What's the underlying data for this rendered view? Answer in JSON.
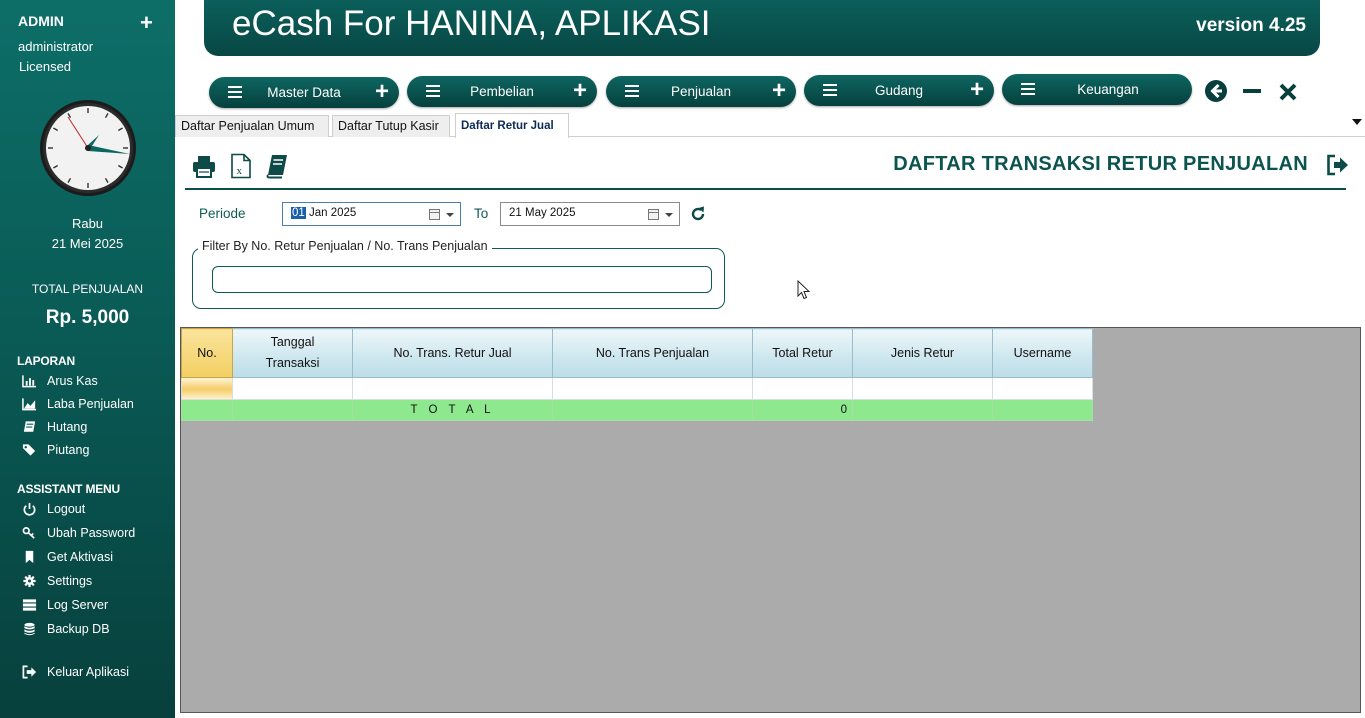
{
  "sidebar": {
    "role": "ADMIN",
    "user": "administrator",
    "license": "Licensed",
    "day": "Rabu",
    "date": "21 Mei 2025",
    "total_penjualan_label": "TOTAL PENJUALAN",
    "total_penjualan_value": "Rp. 5,000",
    "laporan_title": "LAPORAN",
    "laporan": [
      {
        "label": "Arus Kas",
        "icon": "bar-chart-icon"
      },
      {
        "label": "Laba Penjualan",
        "icon": "area-chart-icon"
      },
      {
        "label": "Hutang",
        "icon": "book-icon"
      },
      {
        "label": "Piutang",
        "icon": "tags-icon"
      }
    ],
    "assistant_title": "ASSISTANT MENU",
    "assistant": [
      {
        "label": "Logout",
        "icon": "power-icon"
      },
      {
        "label": "Ubah Password",
        "icon": "key-icon"
      },
      {
        "label": "Get Aktivasi",
        "icon": "bookmark-icon"
      },
      {
        "label": "Settings",
        "icon": "gear-icon"
      },
      {
        "label": "Log Server",
        "icon": "server-icon"
      },
      {
        "label": "Backup DB",
        "icon": "database-icon"
      }
    ],
    "exit_label": "Keluar Aplikasi"
  },
  "header": {
    "title": "eCash For HANINA, APLIKASI",
    "version": "version 4.25"
  },
  "menu": [
    "Master Data",
    "Pembelian",
    "Penjualan",
    "Gudang",
    "Keuangan"
  ],
  "tabs": [
    "Daftar Penjualan Umum",
    "Daftar Tutup Kasir",
    "Daftar Retur Jual"
  ],
  "active_tab": 2,
  "page": {
    "title": "DAFTAR TRANSAKSI RETUR PENJUALAN",
    "periode_label": "Periode",
    "to_label": "To",
    "date_from": {
      "day": "01",
      "rest": " Jan  2025"
    },
    "date_to": "21 May  2025",
    "filter_legend": "Filter By No. Retur Penjualan / No. Trans Penjualan",
    "filter_value": ""
  },
  "grid": {
    "columns": [
      {
        "line1": "No.",
        "line2": ""
      },
      {
        "line1": "Tanggal",
        "line2": "Transaksi"
      },
      {
        "line1": "No. Trans. Retur Jual",
        "line2": ""
      },
      {
        "line1": "No. Trans Penjualan",
        "line2": ""
      },
      {
        "line1": "Total Retur",
        "line2": ""
      },
      {
        "line1": "Jenis Retur",
        "line2": ""
      },
      {
        "line1": "Username",
        "line2": ""
      }
    ],
    "total_label": "T O T A L",
    "total_value": "0"
  },
  "colors": {
    "primary": "#0b5f5b",
    "total_row": "#8ee88e",
    "grid_bg": "#ababab"
  }
}
